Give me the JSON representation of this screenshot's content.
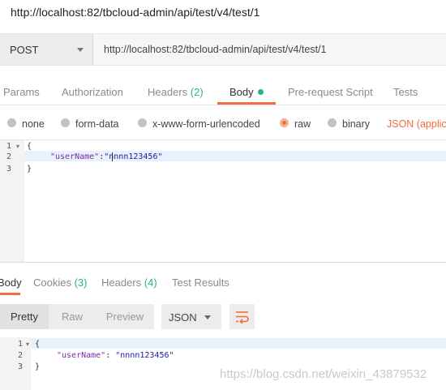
{
  "window": {
    "title": "http://localhost:82/tbcloud-admin/api/test/v4/test/1"
  },
  "request": {
    "method": "POST",
    "url": "http://localhost:82/tbcloud-admin/api/test/v4/test/1"
  },
  "request_tabs": {
    "params": "Params",
    "authorization": "Authorization",
    "headers": "Headers",
    "headers_count": "(2)",
    "body": "Body",
    "prerequest": "Pre-request Script",
    "tests": "Tests"
  },
  "body_types": {
    "none": "none",
    "form_data": "form-data",
    "urlencoded": "x-www-form-urlencoded",
    "raw": "raw",
    "binary": "binary",
    "format": "JSON (applica",
    "selected": "raw"
  },
  "request_editor": {
    "line_numbers": [
      "1",
      "2",
      "3"
    ],
    "line1": "{",
    "line2_key": "\"userName\"",
    "line2_colon": ":",
    "line2_value": "\"nnnn123456\"",
    "line3": "}"
  },
  "response_tabs": {
    "body": "Body",
    "cookies": "Cookies",
    "cookies_count": "(3)",
    "headers": "Headers",
    "headers_count": "(4)",
    "test_results": "Test Results"
  },
  "response_toolbar": {
    "pretty": "Pretty",
    "raw": "Raw",
    "preview": "Preview",
    "format": "JSON",
    "wrap_icon": "wrap-lines-icon"
  },
  "response_editor": {
    "line_numbers": [
      "1",
      "2",
      "3"
    ],
    "line1": "{",
    "line2_key": "\"userName\"",
    "line2_colon": ": ",
    "line2_value": "\"nnnn123456\"",
    "line3": "}"
  },
  "watermark": "https://blog.csdn.net/weixin_43879532",
  "colors": {
    "accent": "#f26b3a",
    "success": "#26b47f",
    "json_key": "#7d2aa6",
    "json_string": "#1a1aa6"
  }
}
